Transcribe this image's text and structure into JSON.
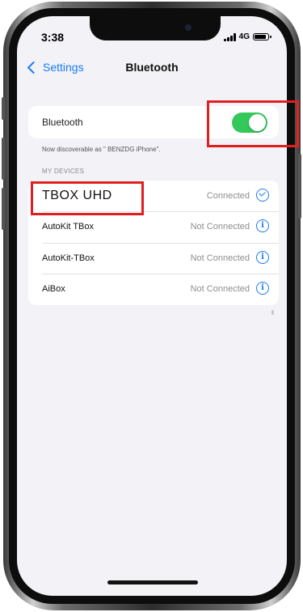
{
  "status_bar": {
    "time": "3:38",
    "network": "4G"
  },
  "nav": {
    "back_label": "Settings",
    "title": "Bluetooth"
  },
  "bluetooth": {
    "toggle_label": "Bluetooth",
    "enabled": true,
    "discoverable_text": "Now discoverable as \" BENZDG iPhone\"."
  },
  "devices": {
    "section_title": "MY DEVICES",
    "items": [
      {
        "name": "TBOX UHD",
        "status": "Connected",
        "icon": "connected-check-icon"
      },
      {
        "name": "AutoKit TBox",
        "status": "Not Connected",
        "icon": "info-icon"
      },
      {
        "name": "AutoKit-TBox",
        "status": "Not Connected",
        "icon": "info-icon"
      },
      {
        "name": "AiBox",
        "status": "Not Connected",
        "icon": "info-icon"
      }
    ]
  },
  "colors": {
    "accent": "#1a7cf0",
    "toggle_on": "#34c759",
    "highlight": "#e02020"
  }
}
